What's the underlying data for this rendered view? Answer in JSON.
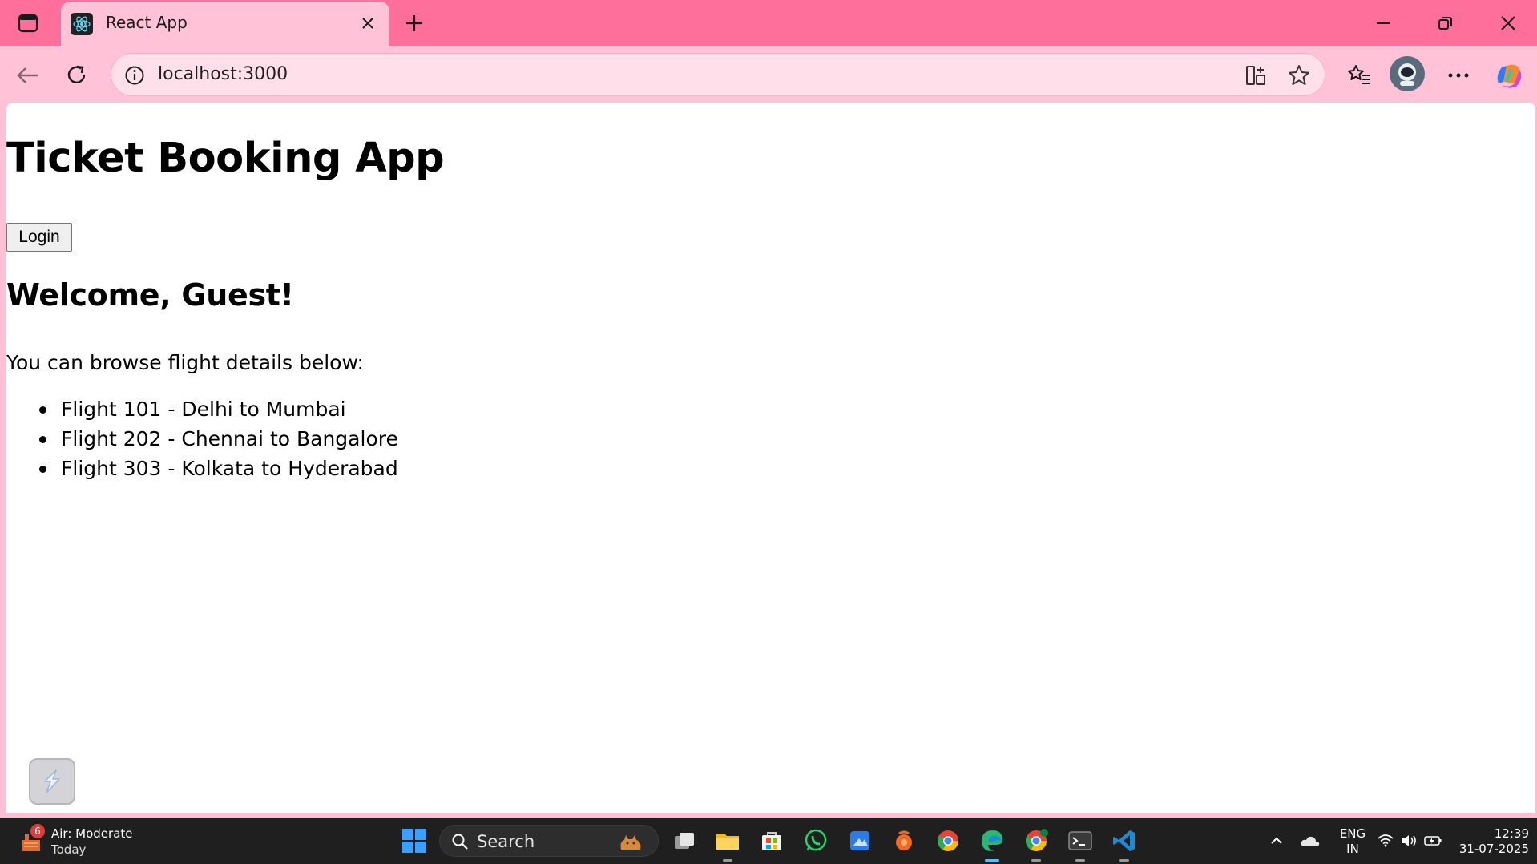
{
  "browser": {
    "tab_title": "React App",
    "address": "localhost:3000"
  },
  "page": {
    "title": "Ticket Booking App",
    "login_label": "Login",
    "welcome": "Welcome, Guest!",
    "intro": "You can browse flight details below:",
    "flights": [
      "Flight 101 - Delhi to Mumbai",
      "Flight 202 - Chennai to Bangalore",
      "Flight 303 - Kolkata to Hyderabad"
    ]
  },
  "taskbar": {
    "weather_badge": "6",
    "weather_title": "Air: Moderate",
    "weather_sub": "Today",
    "search_label": "Search",
    "lang_line1": "ENG",
    "lang_line2": "IN",
    "time": "12:39",
    "date": "31-07-2025"
  },
  "colors": {
    "titlebar": "#ff6f9c",
    "toolbar": "#ffc2d6",
    "page_background": "#ffffff",
    "taskbar": "#1f1f1f"
  }
}
